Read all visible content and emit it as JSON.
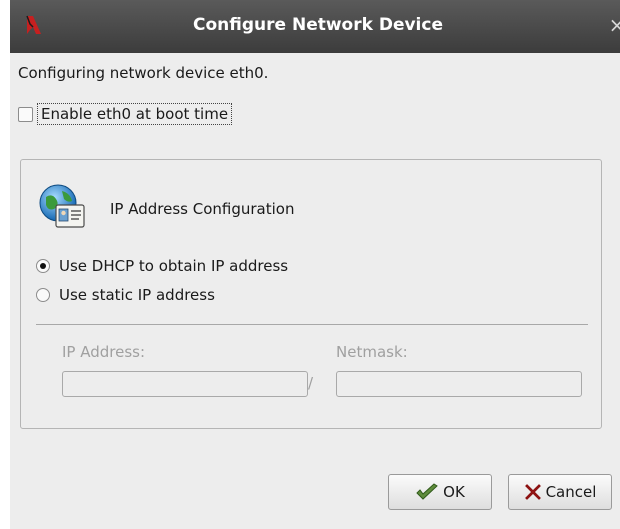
{
  "window": {
    "title": "Configure Network Device",
    "close_glyph": "×"
  },
  "description": "Configuring network device eth0.",
  "boot_checkbox": {
    "label": "Enable eth0 at boot time",
    "checked": false
  },
  "ip_group": {
    "title": "IP Address Configuration",
    "icon": "network-card-icon",
    "options": [
      {
        "label": "Use DHCP to obtain IP address",
        "selected": true
      },
      {
        "label": "Use static IP address",
        "selected": false
      }
    ],
    "ip_label": "IP Address:",
    "ip_value": "",
    "separator": "/",
    "netmask_label": "Netmask:",
    "netmask_value": ""
  },
  "buttons": {
    "ok": "OK",
    "cancel": "Cancel"
  },
  "colors": {
    "titlebar": "#4a4a4a",
    "dialog_bg": "#ededed",
    "disabled_text": "#a0a0a0",
    "ok_icon": "#5f8c3c",
    "cancel_icon": "#c62828"
  }
}
